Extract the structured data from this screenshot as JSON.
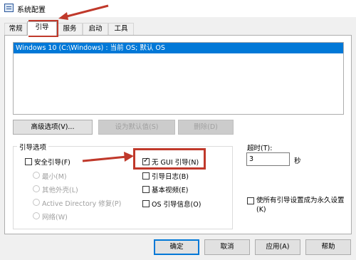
{
  "window": {
    "title": "系统配置"
  },
  "tabs": [
    {
      "label": "常规"
    },
    {
      "label": "引导"
    },
    {
      "label": "服务"
    },
    {
      "label": "启动"
    },
    {
      "label": "工具"
    }
  ],
  "os_list": {
    "items": [
      "Windows 10 (C:\\Windows) : 当前 OS; 默认 OS"
    ]
  },
  "os_buttons": {
    "advanced": "高级选项(V)...",
    "set_default": "设为默认值(S)",
    "delete": "删除(D)"
  },
  "boot_options": {
    "group_label": "引导选项",
    "safe_boot": "安全引导(F)",
    "minimal": "最小(M)",
    "alternate_shell": "其他外壳(L)",
    "active_directory": "Active Directory 修复(P)",
    "network": "网络(W)",
    "no_gui_boot": "无 GUI 引导(N)",
    "boot_log": "引导日志(B)",
    "base_video": "基本视频(E)",
    "os_boot_info": "OS 引导信息(O)"
  },
  "timeout": {
    "label": "超时(T):",
    "value": "3",
    "unit": "秒"
  },
  "make_permanent": "使所有引导设置成为永久设置(K)",
  "footer": {
    "ok": "确定",
    "cancel": "取消",
    "apply": "应用(A)",
    "help": "帮助"
  },
  "colors": {
    "selection": "#0078d7",
    "annotation": "#c0392b"
  }
}
